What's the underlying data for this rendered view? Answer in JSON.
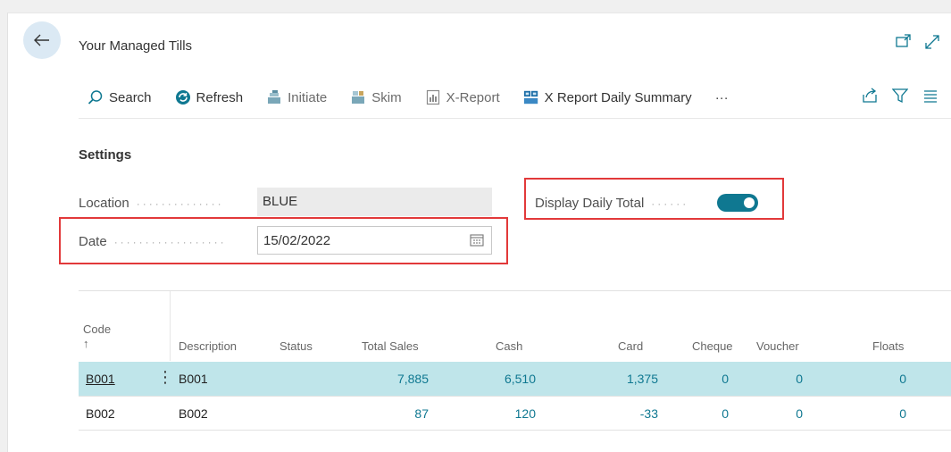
{
  "page": {
    "title": "Your Managed Tills"
  },
  "toolbar": {
    "search": "Search",
    "refresh": "Refresh",
    "initiate": "Initiate",
    "skim": "Skim",
    "x_report": "X-Report",
    "x_report_daily": "X Report Daily Summary",
    "more": "···"
  },
  "settings": {
    "title": "Settings",
    "location_label": "Location",
    "location_value": "BLUE",
    "date_label": "Date",
    "date_value": "15/02/2022",
    "display_daily_total_label": "Display Daily Total",
    "display_daily_total_on": true
  },
  "table": {
    "headers": {
      "code": "Code",
      "code_sort": "↑",
      "description": "Description",
      "status": "Status",
      "total_sales": "Total Sales",
      "cash": "Cash",
      "card": "Card",
      "cheque": "Cheque",
      "voucher": "Voucher",
      "floats": "Floats"
    },
    "rows": [
      {
        "code": "B001",
        "description": "B001",
        "status": "",
        "total_sales": "7,885",
        "cash": "6,510",
        "card": "1,375",
        "cheque": "0",
        "voucher": "0",
        "floats": "0"
      },
      {
        "code": "B002",
        "description": "B002",
        "status": "",
        "total_sales": "87",
        "cash": "120",
        "card": "-33",
        "cheque": "0",
        "voucher": "0",
        "floats": "0"
      }
    ]
  },
  "colors": {
    "accent": "#0f7891",
    "highlight": "#e2393a",
    "selected_row": "#bfe5ea"
  }
}
